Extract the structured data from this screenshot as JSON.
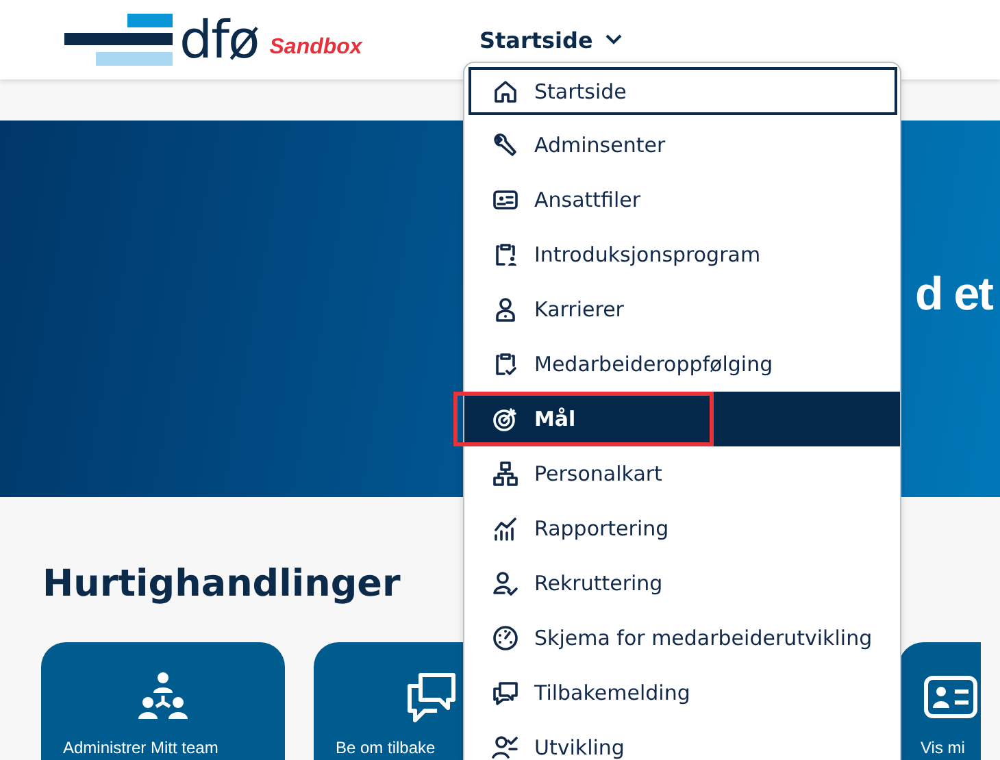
{
  "header": {
    "logo_text": "dfø",
    "environment": "Sandbox",
    "nav_menu": {
      "label": "Startside",
      "expanded": true
    }
  },
  "hero": {
    "title": "d et"
  },
  "nav_dropdown": {
    "items": [
      {
        "label": "Startside",
        "selected": false,
        "focused": true
      },
      {
        "label": "Adminsenter",
        "selected": false,
        "focused": false
      },
      {
        "label": "Ansattfiler",
        "selected": false,
        "focused": false
      },
      {
        "label": "Introduksjonsprogram",
        "selected": false,
        "focused": false
      },
      {
        "label": "Karrierer",
        "selected": false,
        "focused": false
      },
      {
        "label": "Medarbeideroppfølging",
        "selected": false,
        "focused": false
      },
      {
        "label": "Mål",
        "selected": true,
        "focused": false
      },
      {
        "label": "Personalkart",
        "selected": false,
        "focused": false
      },
      {
        "label": "Rapportering",
        "selected": false,
        "focused": false
      },
      {
        "label": "Rekruttering",
        "selected": false,
        "focused": false
      },
      {
        "label": "Skjema for medarbeiderutvikling",
        "selected": false,
        "focused": false
      },
      {
        "label": "Tilbakemelding",
        "selected": false,
        "focused": false
      },
      {
        "label": "Utvikling",
        "selected": false,
        "focused": false
      }
    ]
  },
  "quick_actions": {
    "title": "Hurtighandlinger",
    "cards": [
      {
        "label": "Administrer Mitt team"
      },
      {
        "label": "Be om tilbake"
      },
      {
        "label": "Vis mi"
      }
    ]
  },
  "annotation": {
    "frame_on_selected": true
  }
}
